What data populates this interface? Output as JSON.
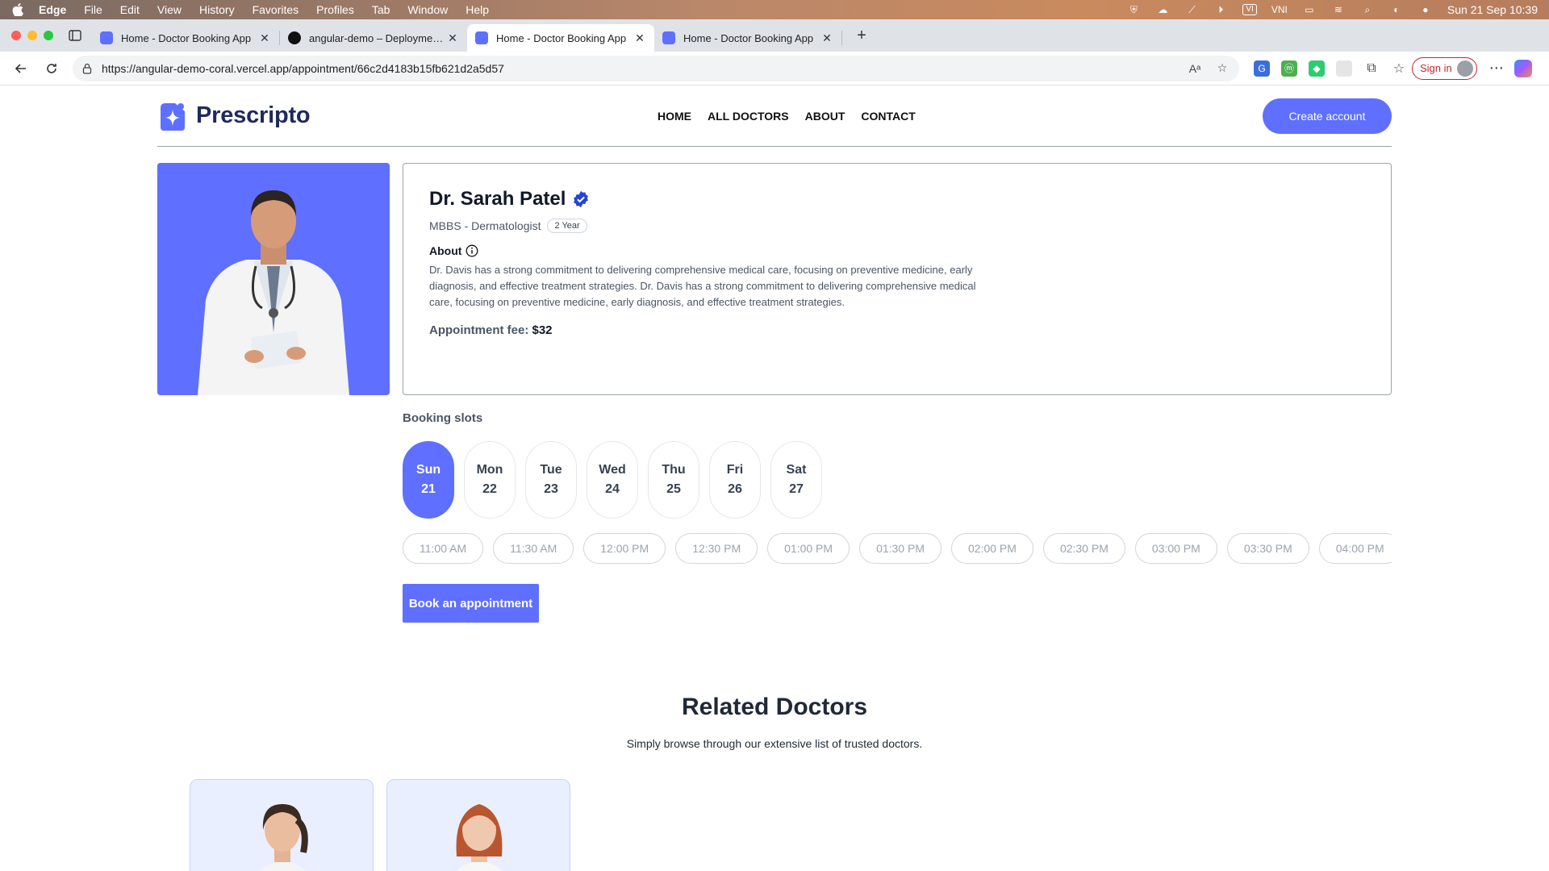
{
  "menubar": {
    "app": "Edge",
    "items": [
      "File",
      "Edit",
      "View",
      "History",
      "Favorites",
      "Profiles",
      "Tab",
      "Window",
      "Help"
    ],
    "input_method": "VI",
    "input_label": "VNI",
    "datetime": "Sun 21 Sep  10:39"
  },
  "tabs": [
    {
      "title": "Home - Doctor Booking App",
      "icon": "prescripto-favicon",
      "active": false
    },
    {
      "title": "angular-demo – Deployment O",
      "icon": "vercel-favicon",
      "active": false
    },
    {
      "title": "Home - Doctor Booking App",
      "icon": "prescripto-favicon",
      "active": true
    },
    {
      "title": "Home - Doctor Booking App",
      "icon": "prescripto-favicon",
      "active": false
    }
  ],
  "toolbar": {
    "url": "https://angular-demo-coral.vercel.app/appointment/66c2d4183b15fb621d2a5d57",
    "signin_label": "Sign in"
  },
  "site": {
    "brand": "Prescripto",
    "nav": [
      "HOME",
      "ALL DOCTORS",
      "ABOUT",
      "CONTACT"
    ],
    "create_account": "Create account"
  },
  "doctor": {
    "name": "Dr. Sarah Patel",
    "degree": "MBBS - Dermatologist",
    "experience": "2 Year",
    "about_label": "About",
    "about": "Dr. Davis has a strong commitment to delivering comprehensive medical care, focusing on preventive medicine, early diagnosis, and effective treatment strategies. Dr. Davis has a strong commitment to delivering comprehensive medical care, focusing on preventive medicine, early diagnosis, and effective treatment strategies.",
    "fee_label": "Appointment fee:",
    "fee": "$32"
  },
  "booking": {
    "title": "Booking slots",
    "days": [
      {
        "day": "Sun",
        "date": "21",
        "selected": true
      },
      {
        "day": "Mon",
        "date": "22",
        "selected": false
      },
      {
        "day": "Tue",
        "date": "23",
        "selected": false
      },
      {
        "day": "Wed",
        "date": "24",
        "selected": false
      },
      {
        "day": "Thu",
        "date": "25",
        "selected": false
      },
      {
        "day": "Fri",
        "date": "26",
        "selected": false
      },
      {
        "day": "Sat",
        "date": "27",
        "selected": false
      }
    ],
    "times": [
      "11:00 AM",
      "11:30 AM",
      "12:00 PM",
      "12:30 PM",
      "01:00 PM",
      "01:30 PM",
      "02:00 PM",
      "02:30 PM",
      "03:00 PM",
      "03:30 PM",
      "04:00 PM"
    ],
    "book_label": "Book an appointment"
  },
  "related": {
    "title": "Related Doctors",
    "subtitle": "Simply browse through our extensive list of trusted doctors."
  },
  "colors": {
    "primary": "#5f6fff",
    "card_bg": "#eaefff"
  }
}
